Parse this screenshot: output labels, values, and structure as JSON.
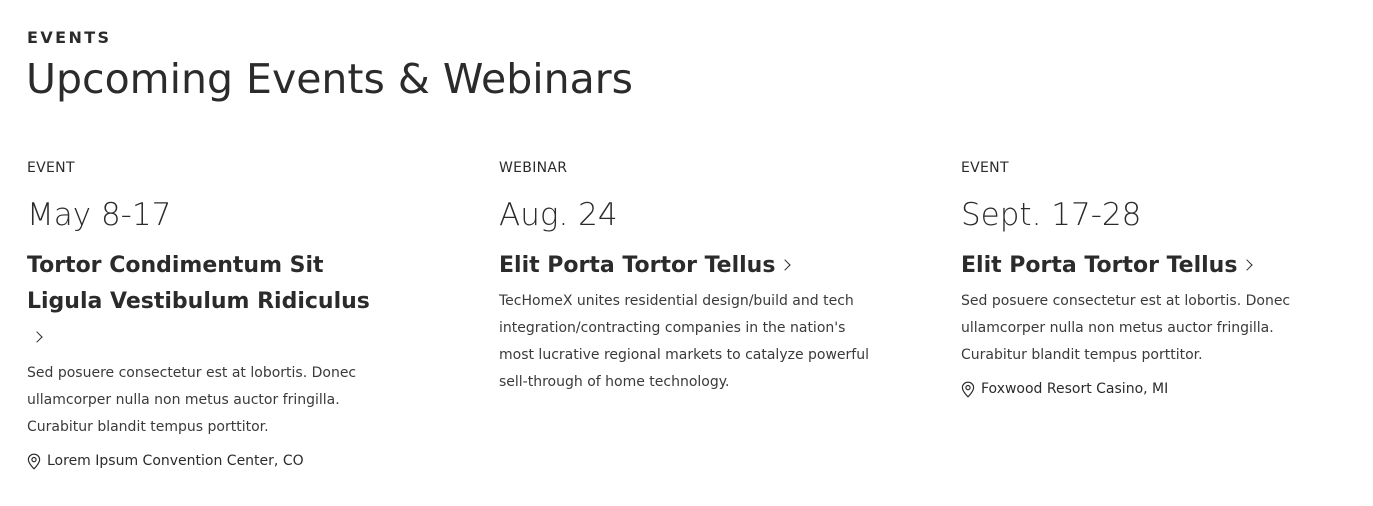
{
  "header": {
    "eyebrow": "EVENTS",
    "title": "Upcoming Events & Webinars"
  },
  "cards": [
    {
      "type": "EVENT",
      "date": "May 8-17",
      "title": "Tortor Condimentum Sit Ligula Vestibulum Ridiculus",
      "description": "Sed posuere consectetur est at lobortis. Donec ullamcorper nulla non metus auctor fringilla. Curabitur blandit tempus porttitor.",
      "location": "Lorem Ipsum Convention Center, CO",
      "location_icon": "map-pin-icon"
    },
    {
      "type": "WEBINAR",
      "date": "Aug. 24",
      "title": "Elit Porta Tortor Tellus",
      "description": "TecHomeX unites residential design/build and tech integration/contracting companies in the nation's most lucrative regional markets to catalyze powerful sell-through of home technology."
    },
    {
      "type": "EVENT",
      "date": "Sept. 17-28",
      "title": "Elit Porta Tortor Tellus",
      "description": "Sed posuere consectetur est at lobortis. Donec ullamcorper nulla non metus auctor fringilla. Curabitur blandit tempus porttitor.",
      "location": "Foxwood Resort Casino, MI",
      "location_icon": "map-pin-icon"
    }
  ],
  "colors": {
    "text": "#2b2b2b",
    "body_text": "#3a3a3a",
    "background": "#ffffff"
  }
}
